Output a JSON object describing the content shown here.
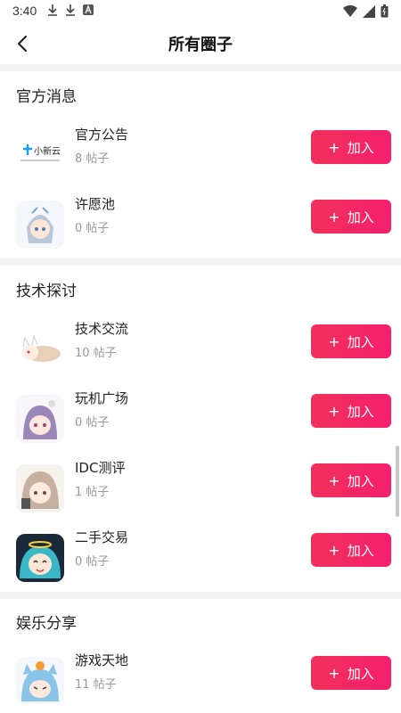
{
  "status_bar": {
    "time": "3:40",
    "left_icons": [
      "download-icon",
      "download-icon",
      "app-notification-icon"
    ],
    "right_icons": [
      "wifi-icon",
      "signal-icon",
      "battery-icon"
    ]
  },
  "header": {
    "title": "所有圈子",
    "back_icon": "chevron-left-icon"
  },
  "join_label": "加入",
  "sections": [
    {
      "title": "官方消息",
      "items": [
        {
          "name": "官方公告",
          "posts": "8 帖子"
        },
        {
          "name": "许愿池",
          "posts": "0 帖子"
        }
      ]
    },
    {
      "title": "技术探讨",
      "items": [
        {
          "name": "技术交流",
          "posts": "10 帖子"
        },
        {
          "name": "玩机广场",
          "posts": "0 帖子"
        },
        {
          "name": "IDC测评",
          "posts": "1 帖子"
        },
        {
          "name": "二手交易",
          "posts": "0 帖子"
        }
      ]
    },
    {
      "title": "娱乐分享",
      "items": [
        {
          "name": "游戏天地",
          "posts": "11 帖子"
        }
      ]
    }
  ],
  "colors": {
    "accent_start": "#f0305a",
    "accent_end": "#f51f6e",
    "divider": "#f2f2f4"
  }
}
